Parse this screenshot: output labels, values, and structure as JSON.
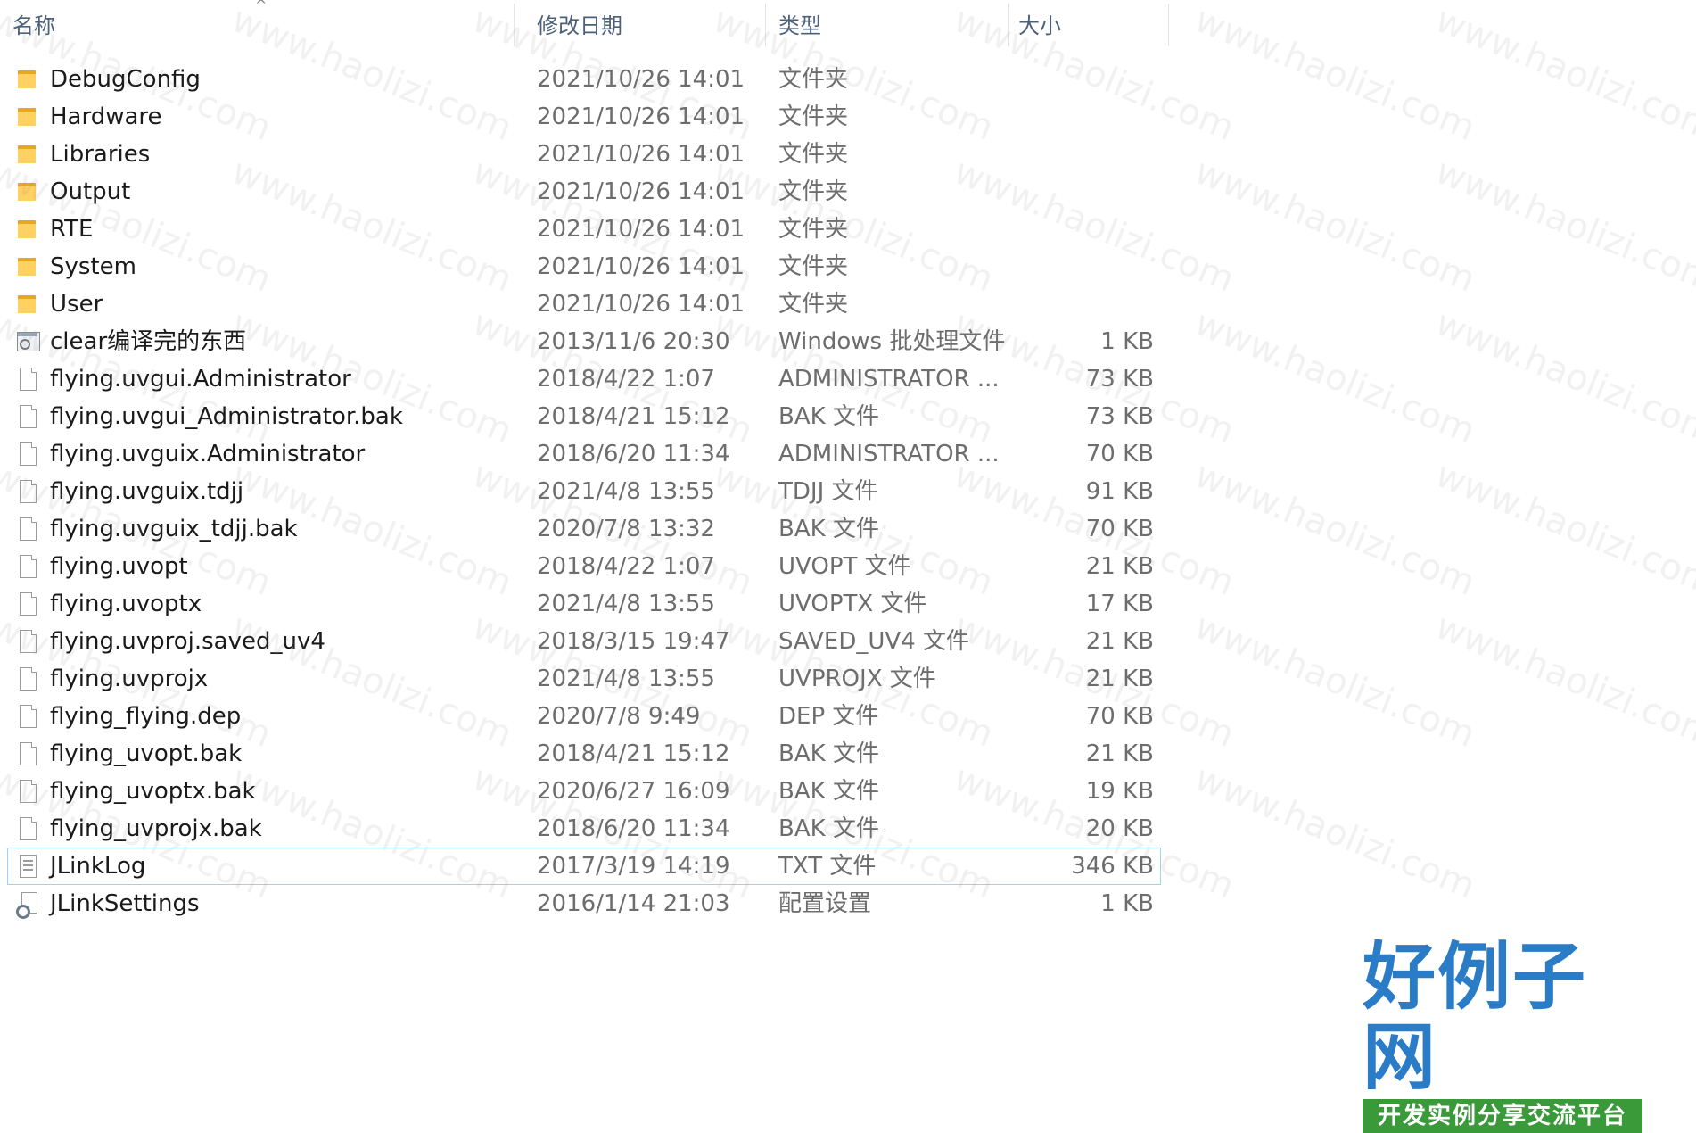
{
  "columns": {
    "name": "名称",
    "date": "修改日期",
    "type": "类型",
    "size": "大小"
  },
  "files": [
    {
      "name": "DebugConfig",
      "date": "2021/10/26 14:01",
      "type": "文件夹",
      "size": "",
      "icon": "folder-icon"
    },
    {
      "name": "Hardware",
      "date": "2021/10/26 14:01",
      "type": "文件夹",
      "size": "",
      "icon": "folder-icon"
    },
    {
      "name": "Libraries",
      "date": "2021/10/26 14:01",
      "type": "文件夹",
      "size": "",
      "icon": "folder-icon"
    },
    {
      "name": "Output",
      "date": "2021/10/26 14:01",
      "type": "文件夹",
      "size": "",
      "icon": "folder-icon"
    },
    {
      "name": "RTE",
      "date": "2021/10/26 14:01",
      "type": "文件夹",
      "size": "",
      "icon": "folder-icon"
    },
    {
      "name": "System",
      "date": "2021/10/26 14:01",
      "type": "文件夹",
      "size": "",
      "icon": "folder-icon"
    },
    {
      "name": "User",
      "date": "2021/10/26 14:01",
      "type": "文件夹",
      "size": "",
      "icon": "folder-icon"
    },
    {
      "name": "clear编译完的东西",
      "date": "2013/11/6 20:30",
      "type": "Windows 批处理文件",
      "size": "1 KB",
      "icon": "batch-file-icon"
    },
    {
      "name": "flying.uvgui.Administrator",
      "date": "2018/4/22 1:07",
      "type": "ADMINISTRATOR ...",
      "size": "73 KB",
      "icon": "file-icon"
    },
    {
      "name": "flying.uvgui_Administrator.bak",
      "date": "2018/4/21 15:12",
      "type": "BAK 文件",
      "size": "73 KB",
      "icon": "file-icon"
    },
    {
      "name": "flying.uvguix.Administrator",
      "date": "2018/6/20 11:34",
      "type": "ADMINISTRATOR ...",
      "size": "70 KB",
      "icon": "file-icon"
    },
    {
      "name": "flying.uvguix.tdjj",
      "date": "2021/4/8 13:55",
      "type": "TDJJ 文件",
      "size": "91 KB",
      "icon": "file-icon"
    },
    {
      "name": "flying.uvguix_tdjj.bak",
      "date": "2020/7/8 13:32",
      "type": "BAK 文件",
      "size": "70 KB",
      "icon": "file-icon"
    },
    {
      "name": "flying.uvopt",
      "date": "2018/4/22 1:07",
      "type": "UVOPT 文件",
      "size": "21 KB",
      "icon": "file-icon"
    },
    {
      "name": "flying.uvoptx",
      "date": "2021/4/8 13:55",
      "type": "UVOPTX 文件",
      "size": "17 KB",
      "icon": "file-icon"
    },
    {
      "name": "flying.uvproj.saved_uv4",
      "date": "2018/3/15 19:47",
      "type": "SAVED_UV4 文件",
      "size": "21 KB",
      "icon": "file-icon"
    },
    {
      "name": "flying.uvprojx",
      "date": "2021/4/8 13:55",
      "type": "UVPROJX 文件",
      "size": "21 KB",
      "icon": "file-icon"
    },
    {
      "name": "flying_flying.dep",
      "date": "2020/7/8 9:49",
      "type": "DEP 文件",
      "size": "70 KB",
      "icon": "file-icon"
    },
    {
      "name": "flying_uvopt.bak",
      "date": "2018/4/21 15:12",
      "type": "BAK 文件",
      "size": "21 KB",
      "icon": "file-icon"
    },
    {
      "name": "flying_uvoptx.bak",
      "date": "2020/6/27 16:09",
      "type": "BAK 文件",
      "size": "19 KB",
      "icon": "file-icon"
    },
    {
      "name": "flying_uvprojx.bak",
      "date": "2018/6/20 11:34",
      "type": "BAK 文件",
      "size": "20 KB",
      "icon": "file-icon"
    },
    {
      "name": "JLinkLog",
      "date": "2017/3/19 14:19",
      "type": "TXT 文件",
      "size": "346 KB",
      "icon": "text-file-icon",
      "selected": true
    },
    {
      "name": "JLinkSettings",
      "date": "2016/1/14 21:03",
      "type": "配置设置",
      "size": "1 KB",
      "icon": "settings-file-icon"
    }
  ],
  "watermark": "www.haolizi.com",
  "logo": {
    "main": "好例子网",
    "sub": "开发实例分享交流平台"
  }
}
